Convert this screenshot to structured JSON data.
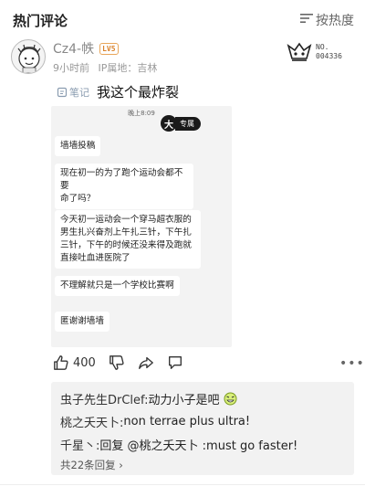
{
  "header": {
    "title": "热门评论",
    "sort_label": "按热度",
    "sort_icon": "sort-lines-icon"
  },
  "comment": {
    "username": "Cz4-帙",
    "level": "LV5",
    "time": "9小时前",
    "location": "IP属地：吉林",
    "emblem_no": "NO.",
    "emblem_code": "004336",
    "note_tag": "笔记",
    "text": "我这个最炸裂",
    "likes": "400",
    "more_icon": "more-dots-icon"
  },
  "screenshot": {
    "status_time": "晚上8:09",
    "badge_glyph": "大",
    "badge_label": "专属",
    "messages": [
      "墙墙投稿",
      "现在初一的为了跑个运动会都不要\n命了吗？",
      "今天初一运动会一个穿马超衣服的\n男生扎兴奋剂上午扎三针，下午扎\n三针，下午的时候还没来得及跑就\n直接吐血进医院了",
      "不理解就只是一个学校比赛啊",
      "匿谢谢墙墙"
    ]
  },
  "replies": [
    {
      "name": "虫子先生DrClef:",
      "text": " 动力小子是吧"
    },
    {
      "name": "桃之夭天卜:",
      "text": " non terrae plus ultra!"
    },
    {
      "name": "千星丶:",
      "text": " 回复 @桃之夭天卜 :must go faster!"
    }
  ],
  "more_replies": "共22条回复",
  "colors": {
    "accent_badge": "#d9822b",
    "note_tag": "#8a9cb0",
    "reply_bg": "#f2f2f2"
  }
}
